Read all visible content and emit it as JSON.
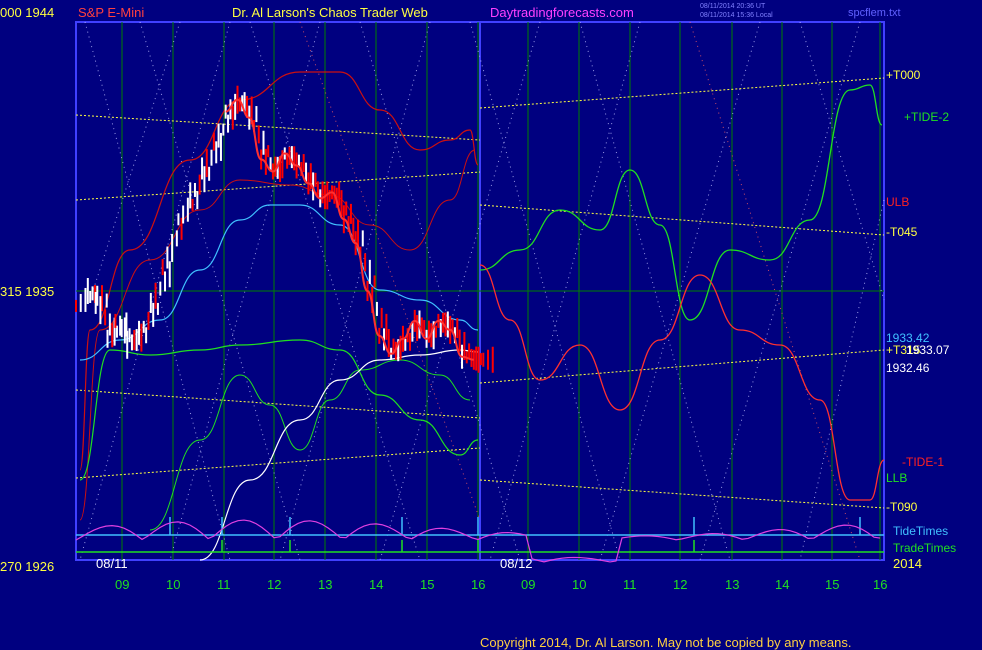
{
  "header": {
    "left_price_top": "000  1944",
    "symbol": "S&P E-Mini",
    "site_title": "Dr. Al Larson's Chaos Trader Web",
    "site_url": "Daytradingforecasts.com",
    "timestamp_1": "08/11/2014 20:36 UT",
    "timestamp_2": "08/11/2014 15:36 Local",
    "file_name": "spcflem.txt"
  },
  "left_axis": {
    "mid_label": "315  1935",
    "bottom_label": "270  1926"
  },
  "right_labels": {
    "t000": "+T000",
    "tide2": "+TIDE-2",
    "ulb": "ULB",
    "t045": "-T045",
    "price_1": "1933.42",
    "t315": "+T315",
    "price_2": "1933.07",
    "price_3": "1932.46",
    "tide1": "-TIDE-1",
    "llb": "LLB",
    "t090": "-T090",
    "tide_times": "TideTimes",
    "trade_times": "TradeTimes",
    "year": "2014"
  },
  "date_labels": [
    "08/11",
    "08/12"
  ],
  "x_ticks": [
    "09",
    "10",
    "11",
    "12",
    "13",
    "14",
    "15",
    "16",
    "09",
    "10",
    "11",
    "12",
    "13",
    "14",
    "15",
    "16"
  ],
  "footer": {
    "copyright": "Copyright 2014, Dr. Al Larson. May not be copied by any means."
  },
  "colors": {
    "background": "#000080",
    "frame": "#4040ff",
    "price_white": "#ffffff",
    "price_red": "#ff0000",
    "fast_red": "#ff3030",
    "band_red": "#cc1010",
    "cyan": "#40c0ff",
    "green": "#20e020",
    "magenta": "#e040e0",
    "yellow": "#ffff40",
    "grid_green": "#008000",
    "tick_green": "#20e020",
    "copyright": "#ffd040",
    "title_yellow": "#ffff40",
    "url_magenta": "#ff40ff",
    "symbol_red": "#ff4040"
  },
  "chart_data": {
    "type": "line",
    "title": "S&P E-Mini",
    "ylim": [
      1926,
      1944
    ],
    "y_ticks": [
      1926,
      1935,
      1944
    ],
    "x_days": [
      "08/11",
      "08/12"
    ],
    "x_hours": [
      9,
      10,
      11,
      12,
      13,
      14,
      15,
      16
    ],
    "price_bars": [
      [
        0.0,
        1934.5
      ],
      [
        0.3,
        1935.0
      ],
      [
        0.5,
        1934.6
      ],
      [
        0.8,
        1933.4
      ],
      [
        1.0,
        1934.0
      ],
      [
        1.3,
        1933.2
      ],
      [
        1.6,
        1933.6
      ],
      [
        1.9,
        1934.6
      ],
      [
        2.2,
        1935.8
      ],
      [
        2.6,
        1937.4
      ],
      [
        2.9,
        1938.2
      ],
      [
        3.2,
        1939.1
      ],
      [
        3.5,
        1940.0
      ],
      [
        3.8,
        1941.0
      ],
      [
        4.1,
        1941.4
      ],
      [
        4.4,
        1940.8
      ],
      [
        4.7,
        1939.4
      ],
      [
        5.0,
        1939.0
      ],
      [
        5.3,
        1939.6
      ],
      [
        5.6,
        1939.2
      ],
      [
        5.9,
        1938.6
      ],
      [
        6.2,
        1938.1
      ],
      [
        6.5,
        1938.3
      ],
      [
        6.8,
        1937.4
      ],
      [
        7.1,
        1936.6
      ],
      [
        7.4,
        1935.0
      ],
      [
        7.7,
        1933.5
      ],
      [
        8.0,
        1932.9
      ],
      [
        8.3,
        1933.4
      ],
      [
        8.6,
        1934.0
      ],
      [
        8.9,
        1933.4
      ],
      [
        9.2,
        1934.0
      ],
      [
        9.5,
        1933.7
      ],
      [
        9.8,
        1932.8
      ],
      [
        10.1,
        1932.7
      ]
    ],
    "series": [
      {
        "name": "ULB",
        "values": [
          1936,
          1937.6,
          1939.6,
          1941.8,
          1942.3,
          1942.4,
          1942.2,
          1941.3,
          1939.6,
          1937.8,
          1936.7,
          1936.1
        ]
      },
      {
        "name": "LLB",
        "values": [
          1934,
          1933.3,
          1932.6,
          1932.9,
          1933.2,
          1932.9,
          1931.5,
          1930.2,
          1929.7,
          1930.5,
          1931.3,
          1930.4
        ]
      },
      {
        "name": "+TIDE-2",
        "values": [
          1938.1,
          1937.5,
          1936.8,
          1939.0,
          1938.7,
          1939.5,
          1936.2,
          1934.5,
          1936.5,
          1937.3,
          1941.5,
          1943.1,
          1942.0
        ]
      },
      {
        "name": "-TIDE-1",
        "values": [
          1936.2,
          1934.6,
          1932.7,
          1933.5,
          1935.4,
          1934.2,
          1933.0,
          1928.5,
          1927.6,
          1928.5
        ]
      },
      {
        "name": "+T000",
        "values": [
          1941.8,
          1943.2
        ]
      },
      {
        "name": "-T045",
        "values": [
          1939.3,
          1937.3
        ]
      },
      {
        "name": "+T315",
        "values": [
          1932.8,
          1933.3
        ]
      },
      {
        "name": "-T090",
        "values": [
          1930.6,
          1928.3
        ]
      }
    ],
    "annotations": [
      "1933.42",
      "1933.07",
      "1932.46"
    ]
  }
}
